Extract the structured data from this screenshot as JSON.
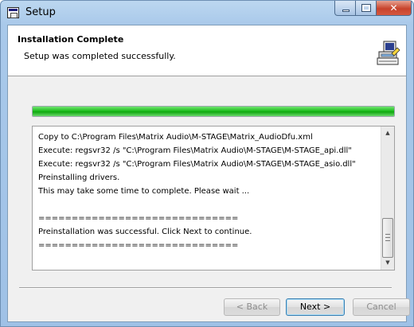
{
  "window": {
    "title": "Setup"
  },
  "header": {
    "title": "Installation Complete",
    "subtitle": "Setup was completed successfully."
  },
  "progress": {
    "fraction": 1.0
  },
  "log": {
    "lines": [
      "Copy to C:\\Program Files\\Matrix Audio\\M-STAGE\\Matrix_AudioDfu.xml",
      "Execute: regsvr32 /s \"C:\\Program Files\\Matrix Audio\\M-STAGE\\M-STAGE_api.dll\"",
      "Execute: regsvr32 /s \"C:\\Program Files\\Matrix Audio\\M-STAGE\\M-STAGE_asio.dll\"",
      "Preinstalling drivers.",
      "This may take some time to complete. Please wait ...",
      "",
      "==============================",
      "Preinstallation was successful. Click Next to continue.",
      "=============================="
    ]
  },
  "buttons": {
    "back": "< Back",
    "next": "Next >",
    "cancel": "Cancel"
  },
  "colors": {
    "progress_fill": "#1fbf1f",
    "title_bar": "#a9c9ea",
    "close_button": "#c7432c"
  },
  "icons": {
    "app": "setup-window-icon",
    "header": "computer-setup-icon",
    "minimize": "minimize-icon",
    "maximize": "maximize-icon",
    "close": "close-icon"
  }
}
